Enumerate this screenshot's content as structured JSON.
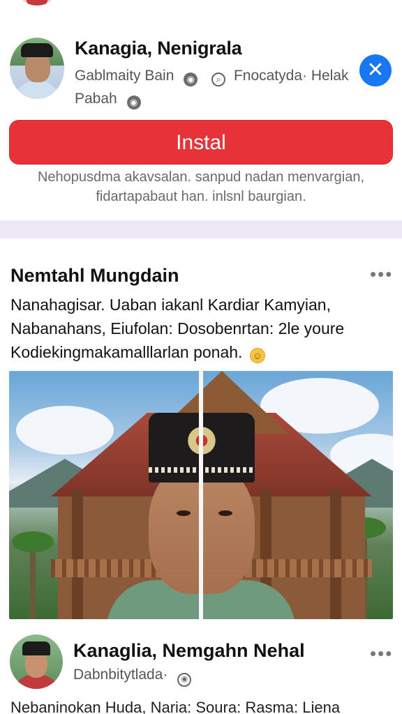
{
  "install_card": {
    "name": "Kanagia, Nenigrala",
    "meta_line1": "Gablmaity Bain",
    "meta_line1b": "Fnocatyda· Helak",
    "meta_line2": "Pabah",
    "install_label": "Instal",
    "description": "Nehopusdma akavsalan. sanpud nadan menvargian, fidartapabaut han. inlsnl baurgian."
  },
  "post": {
    "title": "Nemtahl Mungdain",
    "body": "Nanahagisar. Uaban iakanl Kardiar Kamyian, Nabanahans, Eiufolan: Dosobenrtan: 2le youre Kodiekingmakamalllarlan ponah.",
    "author_name": "Kanaglia, Nemgahn Nehal",
    "author_meta": "Dabnbitytlada·",
    "tail_text": "Nebaninokan Huda, Naria: Soura: Rasma: Liena"
  },
  "icons": {
    "close": "close-icon",
    "globe": "globe-icon",
    "more": "more-icon",
    "emoji": "emoji-icon"
  },
  "colors": {
    "install_button": "#e8323a",
    "close_button": "#1877f2",
    "separator": "#ece8f5"
  }
}
